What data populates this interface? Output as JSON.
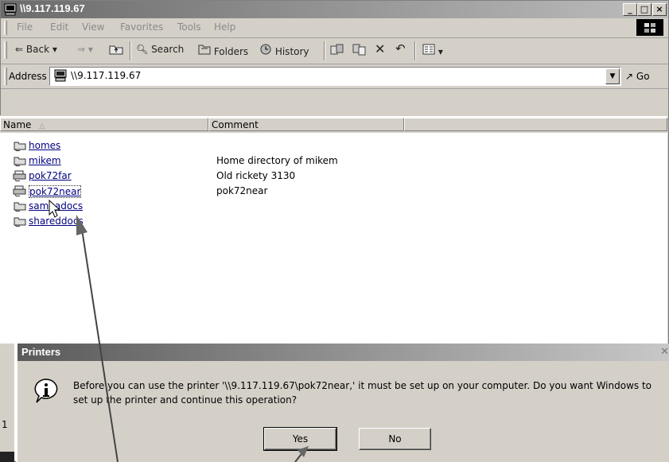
{
  "window": {
    "title": "\\\\9.117.119.67",
    "controls": [
      "_",
      "□",
      "×"
    ]
  },
  "menu": {
    "items": [
      "File",
      "Edit",
      "View",
      "Favorites",
      "Tools",
      "Help"
    ]
  },
  "toolbar": {
    "back": "Back",
    "search": "Search",
    "folders": "Folders",
    "history": "History"
  },
  "address": {
    "label": "Address",
    "value": "\\\\9.117.119.67",
    "go": "Go"
  },
  "list": {
    "columns": [
      "Name",
      "Comment"
    ],
    "rows": [
      {
        "name": "homes",
        "comment": "",
        "icon": "shared-folder-icon"
      },
      {
        "name": "mikem",
        "comment": "Home directory of mikem",
        "icon": "shared-folder-icon"
      },
      {
        "name": "pok72far",
        "comment": "Old rickety 3130",
        "icon": "shared-printer-icon"
      },
      {
        "name": "pok72near",
        "comment": "pok72near",
        "icon": "shared-printer-icon"
      },
      {
        "name": "sambadocs",
        "comment": "",
        "icon": "shared-folder-icon"
      },
      {
        "name": "shareddocs",
        "comment": "",
        "icon": "shared-folder-icon"
      }
    ]
  },
  "dialog": {
    "title": "Printers",
    "message": "Before you can use the printer '\\\\9.117.119.67\\pok72near,' it must be set up on your computer. Do you want Windows to set up the printer and continue this operation?",
    "yes": "Yes",
    "no": "No"
  },
  "status": {
    "left_text": "1"
  },
  "colors": {
    "title_gradient_start": "#6b6b6b",
    "link": "#000080",
    "chrome": "#d4d0c8"
  }
}
